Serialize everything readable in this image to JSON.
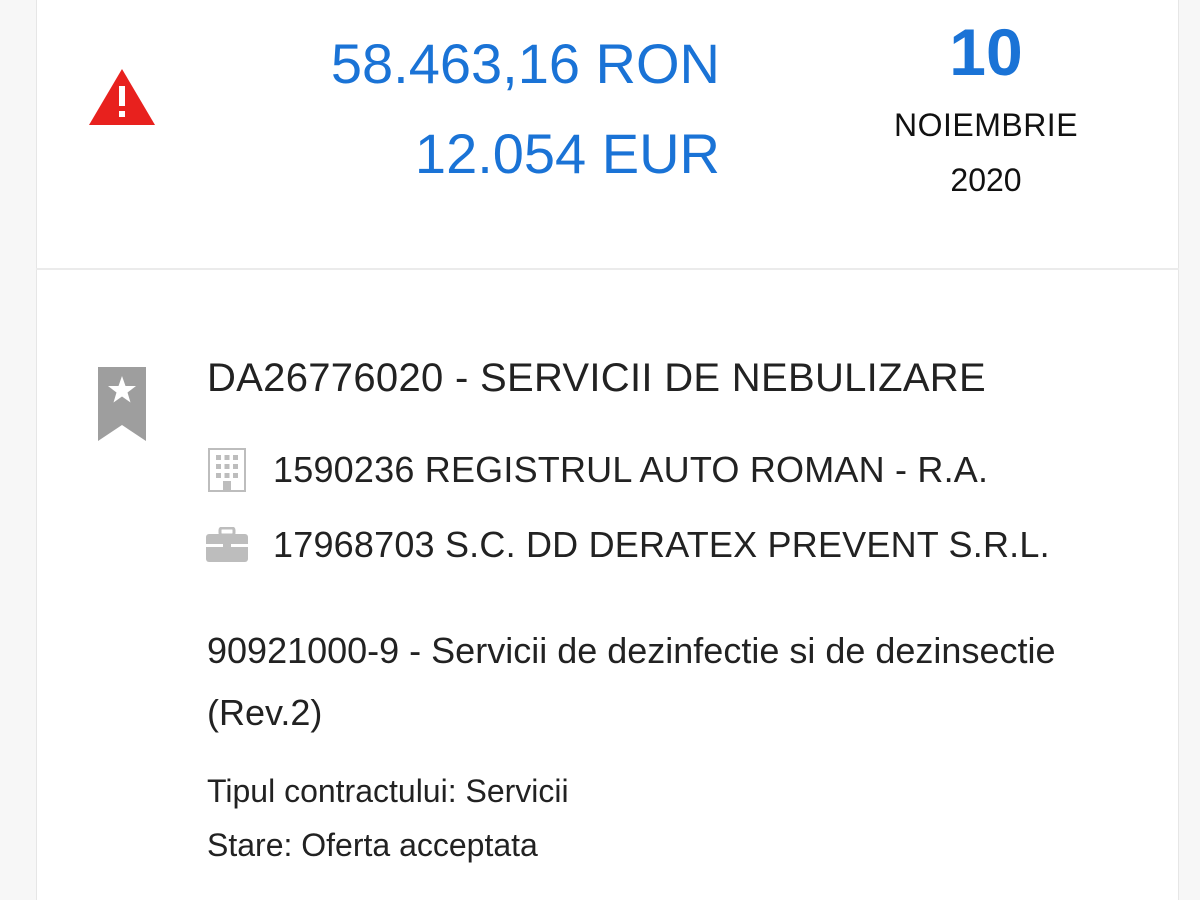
{
  "header": {
    "alert_icon": "warning-triangle-icon",
    "amount_ron": "58.463,16 RON",
    "amount_eur": "12.054 EUR",
    "date": {
      "day": "10",
      "month": "NOIEMBRIE",
      "year": "2020"
    }
  },
  "contract": {
    "bookmark_icon": "bookmark-star-icon",
    "title": "DA26776020 - SERVICII DE NEBULIZARE",
    "authority": {
      "icon": "building-icon",
      "text": "1590236 REGISTRUL AUTO ROMAN - R.A."
    },
    "supplier": {
      "icon": "briefcase-icon",
      "text": "17968703 S.C. DD DERATEX PREVENT S.R.L."
    },
    "cpv": "90921000-9 - Servicii de dezinfectie si de dezinsectie (Rev.2)",
    "contract_type": "Tipul contractului: Servicii",
    "state": "Stare: Oferta acceptata"
  },
  "colors": {
    "accent_blue": "#1a73d6",
    "alert_red": "#e8211e",
    "icon_gray": "#9e9e9e",
    "text": "#222222"
  }
}
